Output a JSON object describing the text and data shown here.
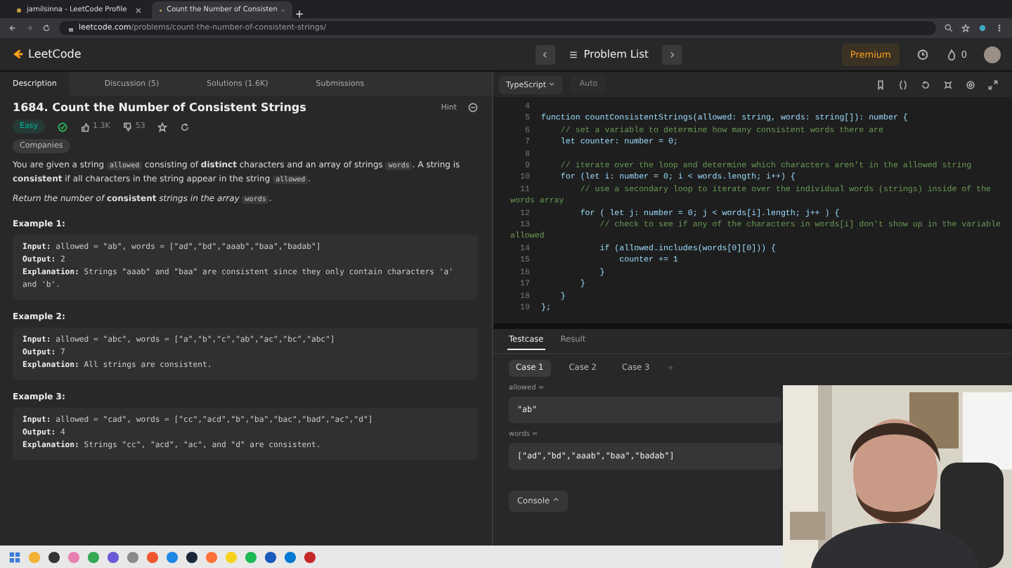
{
  "browser": {
    "tabs": [
      {
        "title": "jamilsinna - LeetCode Profile",
        "selected": false
      },
      {
        "title": "Count the Number of Consisten",
        "selected": true
      }
    ],
    "url_host": "leetcode.com",
    "url_path": "/problems/count-the-number-of-consistent-strings/"
  },
  "header": {
    "logo": "LeetCode",
    "problem_list": "Problem List",
    "premium": "Premium",
    "streak": "0"
  },
  "left_tabs": [
    {
      "label": "Description",
      "selected": true
    },
    {
      "label": "Discussion (5)",
      "selected": false
    },
    {
      "label": "Solutions (1.6K)",
      "selected": false
    },
    {
      "label": "Submissions",
      "selected": false
    }
  ],
  "problem": {
    "title": "1684. Count the Number of Consistent Strings",
    "hint": "Hint",
    "difficulty": "Easy",
    "solved": true,
    "likes": "1.3K",
    "dislikes": "53",
    "companies": "Companies",
    "paragraphs": [
      [
        {
          "kind": "text",
          "text": "You are given a string "
        },
        {
          "kind": "code",
          "text": "allowed"
        },
        {
          "kind": "text",
          "text": " consisting of **distinct** characters and an array of strings "
        },
        {
          "kind": "code",
          "text": "words"
        },
        {
          "kind": "text",
          "text": ". A string is **consistent** if all characters in the string appear in the string "
        },
        {
          "kind": "code",
          "text": "allowed"
        },
        {
          "kind": "text",
          "text": "."
        }
      ],
      [
        {
          "kind": "text",
          "text": "*Return the number of* **consistent** *strings in the array* "
        },
        {
          "kind": "code",
          "text": "words"
        },
        {
          "kind": "text",
          "text": "."
        }
      ]
    ],
    "examples": [
      {
        "title": "Example 1:",
        "lines": [
          {
            "label": "Input:",
            "text": "allowed = \"ab\", words = [\"ad\",\"bd\",\"aaab\",\"baa\",\"badab\"]"
          },
          {
            "label": "Output:",
            "text": "2"
          },
          {
            "label": "Explanation:",
            "text": "Strings \"aaab\" and \"baa\" are consistent since they only contain characters 'a' and 'b'."
          }
        ]
      },
      {
        "title": "Example 2:",
        "lines": [
          {
            "label": "Input:",
            "text": "allowed = \"abc\", words = [\"a\",\"b\",\"c\",\"ab\",\"ac\",\"bc\",\"abc\"]"
          },
          {
            "label": "Output:",
            "text": "7"
          },
          {
            "label": "Explanation:",
            "text": "All strings are consistent."
          }
        ]
      },
      {
        "title": "Example 3:",
        "lines": [
          {
            "label": "Input:",
            "text": "allowed = \"cad\", words = [\"cc\",\"acd\",\"b\",\"ba\",\"bac\",\"bad\",\"ac\",\"d\"]"
          },
          {
            "label": "Output:",
            "text": "4"
          },
          {
            "label": "Explanation:",
            "text": "Strings \"cc\", \"acd\", \"ac\", and \"d\" are consistent."
          }
        ]
      }
    ]
  },
  "editor": {
    "language": "TypeScript",
    "mode": "Auto",
    "lines": [
      {
        "num": "4"
      },
      {
        "num": "5",
        "kind": "code",
        "text": "function countConsistentStrings(allowed: string, words: string[]): number {"
      },
      {
        "num": "6",
        "kind": "comment",
        "text": "    // set a variable to determine how many consistent words there are"
      },
      {
        "num": "7",
        "kind": "code",
        "text": "    let counter: number = 0;"
      },
      {
        "num": "8"
      },
      {
        "num": "9",
        "kind": "comment",
        "text": "    // iterate over the loop and determine which characters aren't in the allowed string"
      },
      {
        "num": "10",
        "kind": "code",
        "text": "    for (let i: number = 0; i < words.length; i++) {"
      },
      {
        "num": "11",
        "kind": "comment",
        "text": "        // use a secondary loop to iterate over the individual words (strings) inside of the",
        "continuation": "words array"
      },
      {
        "num": "12",
        "kind": "code",
        "text": "        for ( let j: number = 0; j < words[i].length; j++ ) {"
      },
      {
        "num": "13",
        "kind": "comment",
        "text": "            // check to see if any of the characters in words[i] don't show up in the variable",
        "continuation": "allowed"
      },
      {
        "num": "14",
        "kind": "code",
        "text": "            if (allowed.includes(words[0][0])) {"
      },
      {
        "num": "15",
        "kind": "code",
        "text": "                counter += 1"
      },
      {
        "num": "16",
        "kind": "code",
        "text": "            }"
      },
      {
        "num": "17",
        "kind": "code",
        "text": "        }"
      },
      {
        "num": "18",
        "kind": "code",
        "text": "    }"
      },
      {
        "num": "19",
        "kind": "code",
        "text": "};"
      }
    ]
  },
  "test_tabs": [
    {
      "label": "Testcase",
      "selected": true
    },
    {
      "label": "Result",
      "selected": false
    }
  ],
  "cases": [
    {
      "label": "Case 1",
      "selected": true
    },
    {
      "label": "Case 2",
      "selected": false
    },
    {
      "label": "Case 3",
      "selected": false
    }
  ],
  "add_case": "+",
  "inputs": [
    {
      "label": "allowed =",
      "value": "\"ab\""
    },
    {
      "label": "words =",
      "value": "[\"ad\",\"bd\",\"aaab\",\"baa\",\"badab\"]"
    }
  ],
  "console": "Console"
}
